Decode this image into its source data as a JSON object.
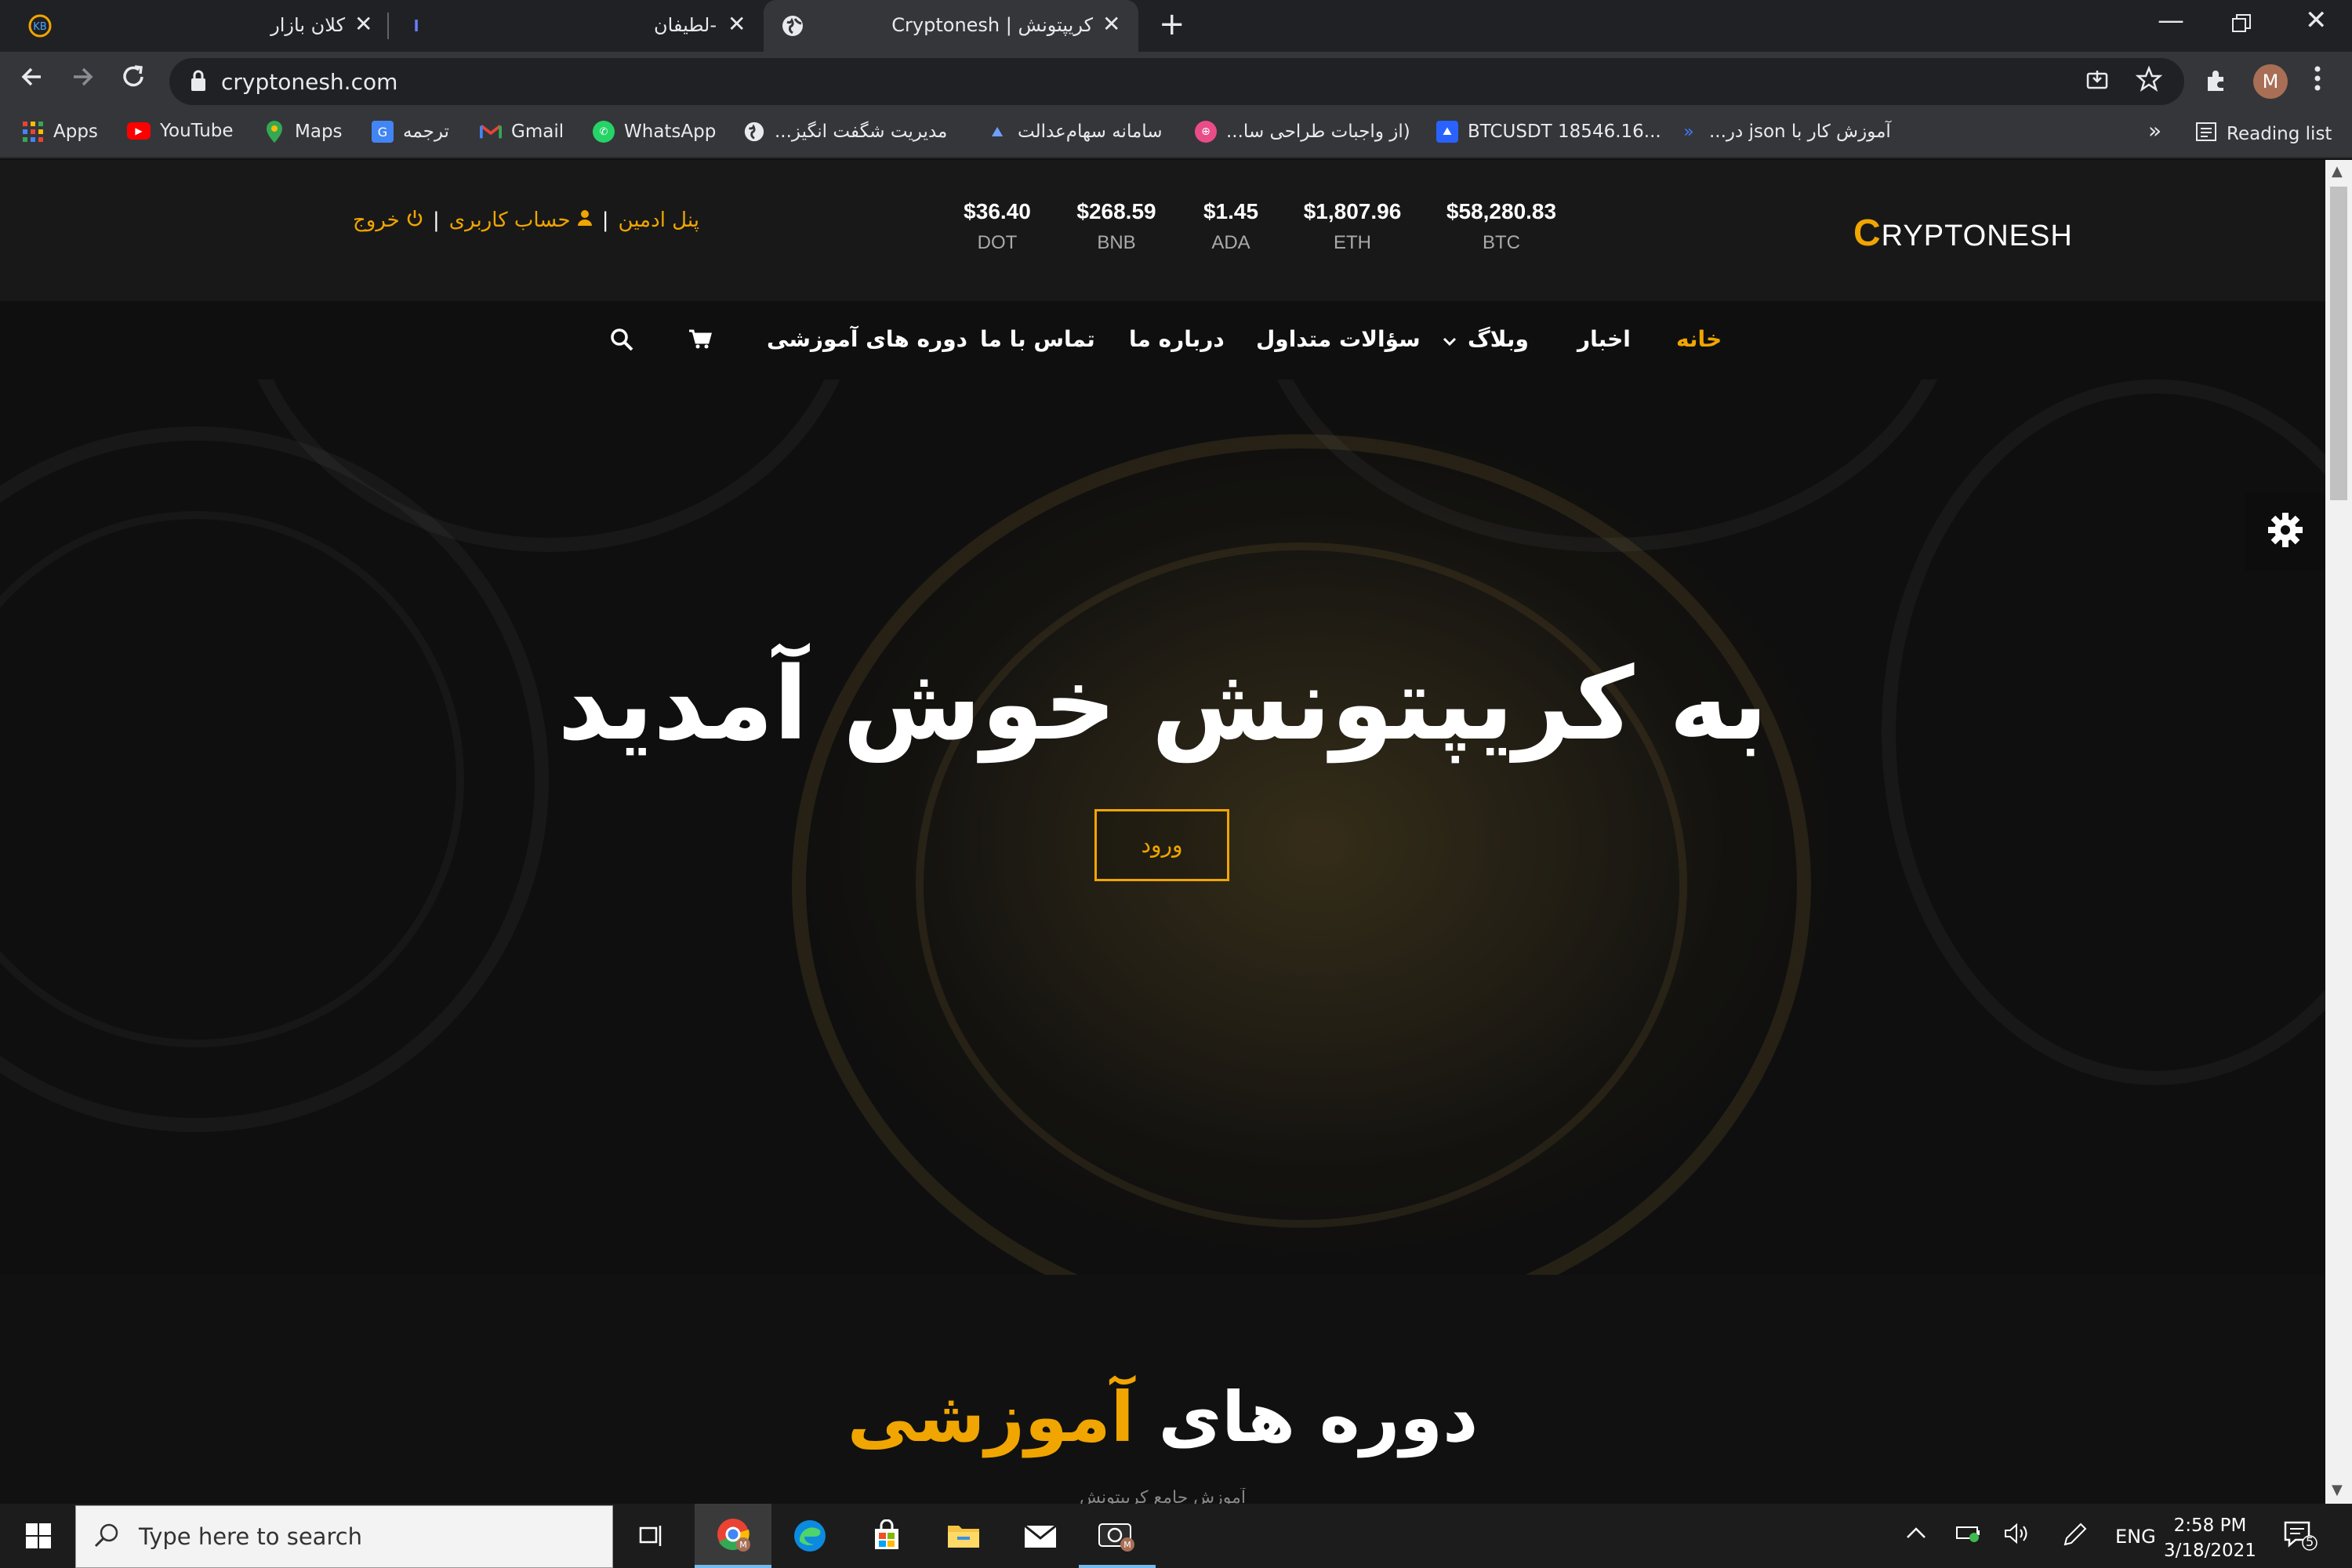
{
  "browser": {
    "tabs": [
      {
        "title": "کلان بازار",
        "favicon": "kb-icon"
      },
      {
        "title": "-لطیفان",
        "favicon": "site-icon"
      },
      {
        "title": "کریپتونش | Cryptonesh",
        "favicon": "globe-icon",
        "active": true
      }
    ],
    "new_tab": "+",
    "url": "cryptonesh.com",
    "profile_initial": "M",
    "bookmarks": [
      {
        "label": "Apps",
        "icon": "apps-grid-icon"
      },
      {
        "label": "YouTube",
        "icon": "youtube-icon"
      },
      {
        "label": "Maps",
        "icon": "maps-icon"
      },
      {
        "label": "ترجمه",
        "icon": "translate-icon"
      },
      {
        "label": "Gmail",
        "icon": "gmail-icon"
      },
      {
        "label": "WhatsApp",
        "icon": "whatsapp-icon"
      },
      {
        "label": "مدیریت شگفت انگیز...",
        "icon": "globe-icon"
      },
      {
        "label": "سامانه سهام‌عدالت",
        "icon": "sahaam-icon"
      },
      {
        "label": "(از واجبات طراحی سا...",
        "icon": "dribbble-icon"
      },
      {
        "label": "BTCUSDT 18546.16...",
        "icon": "tradingview-icon"
      },
      {
        "label": "آموزش کار با json در...",
        "icon": "arrow-icon"
      }
    ],
    "more_bookmarks": "»",
    "reading_list": "Reading list"
  },
  "site": {
    "logo_c": "C",
    "logo_rest": "RYPTONESH",
    "ticker": [
      {
        "price": "$58,280.83",
        "symbol": "BTC"
      },
      {
        "price": "$1,807.96",
        "symbol": "ETH"
      },
      {
        "price": "$1.45",
        "symbol": "ADA"
      },
      {
        "price": "$268.59",
        "symbol": "BNB"
      },
      {
        "price": "$36.40",
        "symbol": "DOT"
      }
    ],
    "user_links": {
      "admin": "پنل ادمین",
      "account": "حساب کاربری",
      "logout": "خروج",
      "sep": "|"
    },
    "nav": [
      {
        "label": "خانه",
        "active": true
      },
      {
        "label": "اخبار"
      },
      {
        "label": "وبلاگ"
      },
      {
        "label": "سؤالات متداول"
      },
      {
        "label": "درباره ما"
      },
      {
        "label": "تماس با ما"
      },
      {
        "label": "دوره های آموزشی"
      }
    ],
    "hero": {
      "title": "به کریپتونش خوش آمدید",
      "button": "ورود"
    },
    "courses": {
      "title_main": "دوره های",
      "title_highlight": "آموزشی",
      "subtitle": "آموزش جامع کریپتونش"
    },
    "accent": "#f0a500"
  },
  "taskbar": {
    "search_placeholder": "Type here to search",
    "lang": "ENG",
    "time": "2:58 PM",
    "date": "3/18/2021",
    "notifications": "5"
  }
}
